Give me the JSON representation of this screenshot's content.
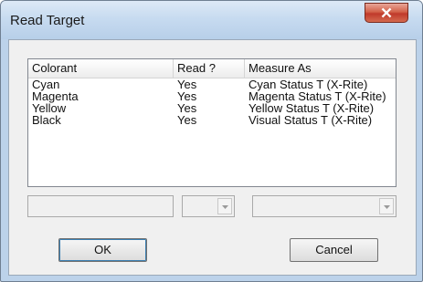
{
  "window": {
    "title": "Read Target"
  },
  "list": {
    "columns": [
      "Colorant",
      "Read ?",
      "Measure As"
    ],
    "rows": [
      [
        "Cyan",
        "Yes",
        "Cyan Status T (X-Rite)"
      ],
      [
        "Magenta",
        "Yes",
        "Magenta Status T (X-Rite)"
      ],
      [
        "Yellow",
        "Yes",
        "Yellow Status T (X-Rite)"
      ],
      [
        "Black",
        "Yes",
        "Visual Status T (X-Rite)"
      ]
    ]
  },
  "editor": {
    "colorant_value": "",
    "read_value": "",
    "measure_value": ""
  },
  "buttons": {
    "ok": "OK",
    "cancel": "Cancel"
  },
  "icons": {
    "close": "close-icon",
    "dropdown": "chevron-down-icon"
  }
}
